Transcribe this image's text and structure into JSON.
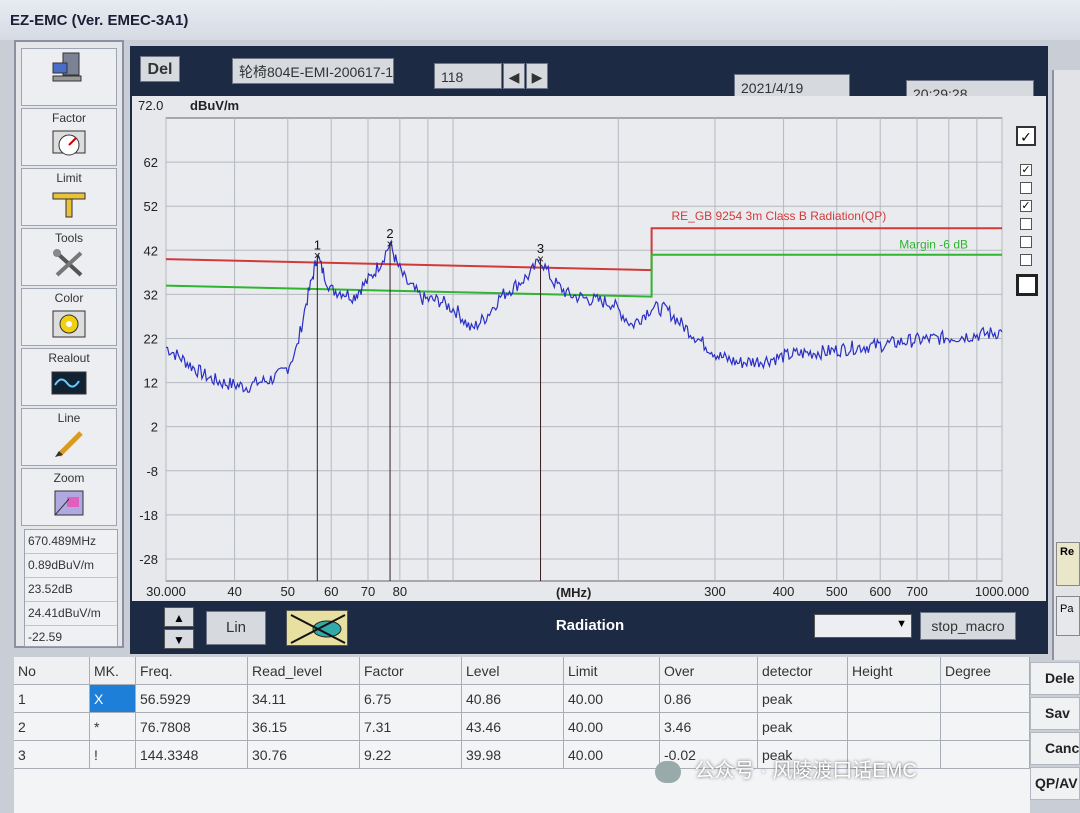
{
  "window": {
    "title": "EZ-EMC  (Ver. EMEC-3A1)"
  },
  "sidebar": {
    "buttons": [
      {
        "label": "",
        "icon": "computer-icon"
      },
      {
        "label": "Factor",
        "icon": "gauge-icon"
      },
      {
        "label": "Limit",
        "icon": "limit-icon"
      },
      {
        "label": "Tools",
        "icon": "tools-icon"
      },
      {
        "label": "Color",
        "icon": "color-icon"
      },
      {
        "label": "Realout",
        "icon": "realout-icon"
      },
      {
        "label": "Line",
        "icon": "line-icon"
      },
      {
        "label": "Zoom",
        "icon": "zoom-icon"
      }
    ],
    "readout": [
      "670.489MHz",
      "0.89dBuV/m",
      "23.52dB",
      "24.41dBuV/m",
      "-22.59"
    ]
  },
  "toolbar": {
    "del_label": "Del",
    "filename": "轮椅804E-EMI-200617-1",
    "record_no": "118",
    "date": "2021/4/19",
    "time": "20:29:28"
  },
  "chart_data": {
    "type": "line",
    "ylabel": "dBuV/m",
    "ymax_label": "72.0",
    "xlabel": "(MHz)",
    "x_scale": "log",
    "xlim": [
      30,
      1000
    ],
    "ylim": [
      -33,
      72
    ],
    "yticks": [
      62,
      52,
      42,
      32,
      22,
      12,
      2,
      -8,
      -18,
      -28
    ],
    "xticks": [
      {
        "v": 30,
        "t": "30.000"
      },
      {
        "v": 40,
        "t": "40"
      },
      {
        "v": 50,
        "t": "50"
      },
      {
        "v": 60,
        "t": "60"
      },
      {
        "v": 70,
        "t": "70"
      },
      {
        "v": 80,
        "t": "80"
      },
      {
        "v": 300,
        "t": "300"
      },
      {
        "v": 400,
        "t": "400"
      },
      {
        "v": 500,
        "t": "500"
      },
      {
        "v": 600,
        "t": "600"
      },
      {
        "v": 700,
        "t": "700"
      },
      {
        "v": 1000,
        "t": "1000.000"
      }
    ],
    "limit_line": {
      "name": "RE_GB 9254 3m Class B Radiation(QP)",
      "color": "#d23a3a",
      "points": [
        [
          30,
          40.0
        ],
        [
          230,
          37.5
        ],
        [
          230,
          47.0
        ],
        [
          1000,
          47.0
        ]
      ]
    },
    "margin_line": {
      "name": "Margin -6 dB",
      "color": "#2fb52f",
      "points": [
        [
          30,
          34.0
        ],
        [
          230,
          31.5
        ],
        [
          230,
          41.0
        ],
        [
          1000,
          41.0
        ]
      ]
    },
    "trace": {
      "color": "#2b2fc4",
      "points": [
        [
          30,
          20.0
        ],
        [
          32,
          17.5
        ],
        [
          34,
          15.0
        ],
        [
          36,
          13.0
        ],
        [
          38,
          12.0
        ],
        [
          40,
          11.5
        ],
        [
          42,
          11.0
        ],
        [
          44,
          12.0
        ],
        [
          46,
          12.5
        ],
        [
          48,
          13.5
        ],
        [
          50,
          15.5
        ],
        [
          52,
          20.0
        ],
        [
          54,
          30.0
        ],
        [
          55.5,
          36.0
        ],
        [
          56.6,
          40.9
        ],
        [
          58,
          37.0
        ],
        [
          60,
          33.0
        ],
        [
          63,
          32.5
        ],
        [
          66,
          31.5
        ],
        [
          68,
          33.5
        ],
        [
          71,
          36.0
        ],
        [
          74,
          39.5
        ],
        [
          76.8,
          43.5
        ],
        [
          79,
          39.0
        ],
        [
          82,
          35.0
        ],
        [
          88,
          31.0
        ],
        [
          95,
          30.5
        ],
        [
          102,
          28.0
        ],
        [
          108,
          24.0
        ],
        [
          115,
          27.0
        ],
        [
          122,
          31.5
        ],
        [
          130,
          34.0
        ],
        [
          138,
          36.5
        ],
        [
          144.3,
          40.0
        ],
        [
          152,
          35.0
        ],
        [
          162,
          32.0
        ],
        [
          175,
          31.0
        ],
        [
          195,
          30.0
        ],
        [
          212,
          25.0
        ],
        [
          230,
          29.0
        ],
        [
          245,
          28.5
        ],
        [
          262,
          25.0
        ],
        [
          285,
          21.0
        ],
        [
          305,
          18.0
        ],
        [
          330,
          16.5
        ],
        [
          370,
          17.0
        ],
        [
          420,
          18.5
        ],
        [
          480,
          19.0
        ],
        [
          540,
          20.0
        ],
        [
          600,
          20.5
        ],
        [
          680,
          21.5
        ],
        [
          760,
          22.0
        ],
        [
          850,
          22.5
        ],
        [
          930,
          23.0
        ],
        [
          1000,
          23.5
        ]
      ]
    },
    "markers": [
      {
        "label": "1",
        "x": 56.5929,
        "y": 40.86
      },
      {
        "label": "2",
        "x": 76.7808,
        "y": 43.46
      },
      {
        "label": "3",
        "x": 144.3348,
        "y": 39.98
      }
    ],
    "grid": true
  },
  "bottombar": {
    "scale_label": "Lin",
    "mode_title": "Radiation",
    "macro_label": "stop_macro",
    "dropdown_value": ""
  },
  "table": {
    "headers": [
      "No",
      "MK.",
      "Freq.",
      "Read_level",
      "Factor",
      "Level",
      "Limit",
      "Over",
      "detector",
      "Height",
      "Degree"
    ],
    "rows": [
      [
        "1",
        "X",
        "56.5929",
        "34.11",
        "6.75",
        "40.86",
        "40.00",
        "0.86",
        "peak",
        "",
        ""
      ],
      [
        "2",
        "*",
        "76.7808",
        "36.15",
        "7.31",
        "43.46",
        "40.00",
        "3.46",
        "peak",
        "",
        ""
      ],
      [
        "3",
        "!",
        "144.3348",
        "30.76",
        "9.22",
        "39.98",
        "40.00",
        "-0.02",
        "peak",
        "",
        ""
      ]
    ]
  },
  "side_actions": [
    "Dele",
    "Sav",
    "Canc",
    "QP/AV"
  ],
  "right_panel": {
    "labels": [
      "Re",
      "Pa"
    ]
  },
  "watermark": "公众号 · 风陵渡口话EMC"
}
